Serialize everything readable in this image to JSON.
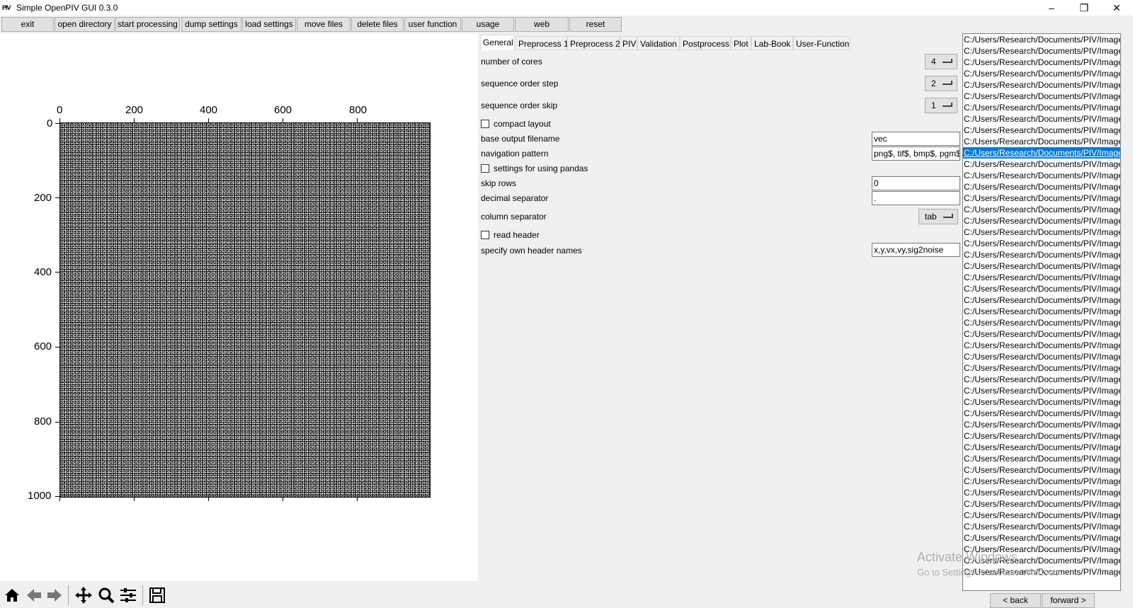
{
  "window": {
    "title": "Simple OpenPIV GUI 0.3.0",
    "icon_text": "PIV",
    "minimize": "–",
    "maximize": "❐",
    "close": "✕"
  },
  "toolbar": {
    "buttons": [
      "exit",
      "open directory",
      "start processing",
      "dump settings",
      "load settings",
      "move files",
      "delete files",
      "user function",
      "usage",
      "web",
      "reset"
    ]
  },
  "plot": {
    "x_ticks": [
      "0",
      "200",
      "400",
      "600",
      "800"
    ],
    "y_ticks": [
      "0",
      "200",
      "400",
      "600",
      "800",
      "1000"
    ],
    "xlim": [
      0,
      1000
    ],
    "ylim": [
      0,
      1000
    ],
    "image_description_icon": "particle-image"
  },
  "nav_toolbar": {
    "icons": [
      "home-icon",
      "back-arrow-icon",
      "forward-arrow-icon",
      "pan-icon",
      "zoom-icon",
      "configure-subplots-icon",
      "save-icon"
    ]
  },
  "tabs": [
    "General",
    "Preprocess 1",
    "Preprocess 2",
    "PIV",
    "Validation",
    "Postprocess",
    "Plot",
    "Lab-Book",
    "User-Function"
  ],
  "active_tab": "General",
  "general": {
    "number_of_cores": {
      "label": "number of cores",
      "value": "4"
    },
    "sequence_order_step": {
      "label": "sequence order step",
      "value": "2"
    },
    "sequence_order_skip": {
      "label": "sequence order skip",
      "value": "1"
    },
    "compact_layout": {
      "label": "compact layout",
      "checked": false
    },
    "base_output_filename": {
      "label": "base output filename",
      "value": "vec"
    },
    "navigation_pattern": {
      "label": "navigation pattern",
      "value": "png$, tif$, bmp$, pgm$"
    },
    "settings_pandas": {
      "label": "settings for using pandas",
      "checked": false
    },
    "skip_rows": {
      "label": "skip rows",
      "value": "0"
    },
    "decimal_separator": {
      "label": "decimal separator",
      "value": "."
    },
    "column_separator": {
      "label": "column separator",
      "value": "tab"
    },
    "read_header": {
      "label": "read header",
      "checked": false
    },
    "header_names": {
      "label": "specify own header names",
      "value": "x,y,vx,vy,sig2noise"
    }
  },
  "file_list": {
    "item_text": "C:/Users/Research/Documents/PIV/Images",
    "count": 48,
    "selected_index": 10
  },
  "file_nav": {
    "back": "< back",
    "forward": "forward >"
  },
  "watermark": {
    "line1": "Activate Windows",
    "line2": "Go to Settings to activate Windows."
  }
}
